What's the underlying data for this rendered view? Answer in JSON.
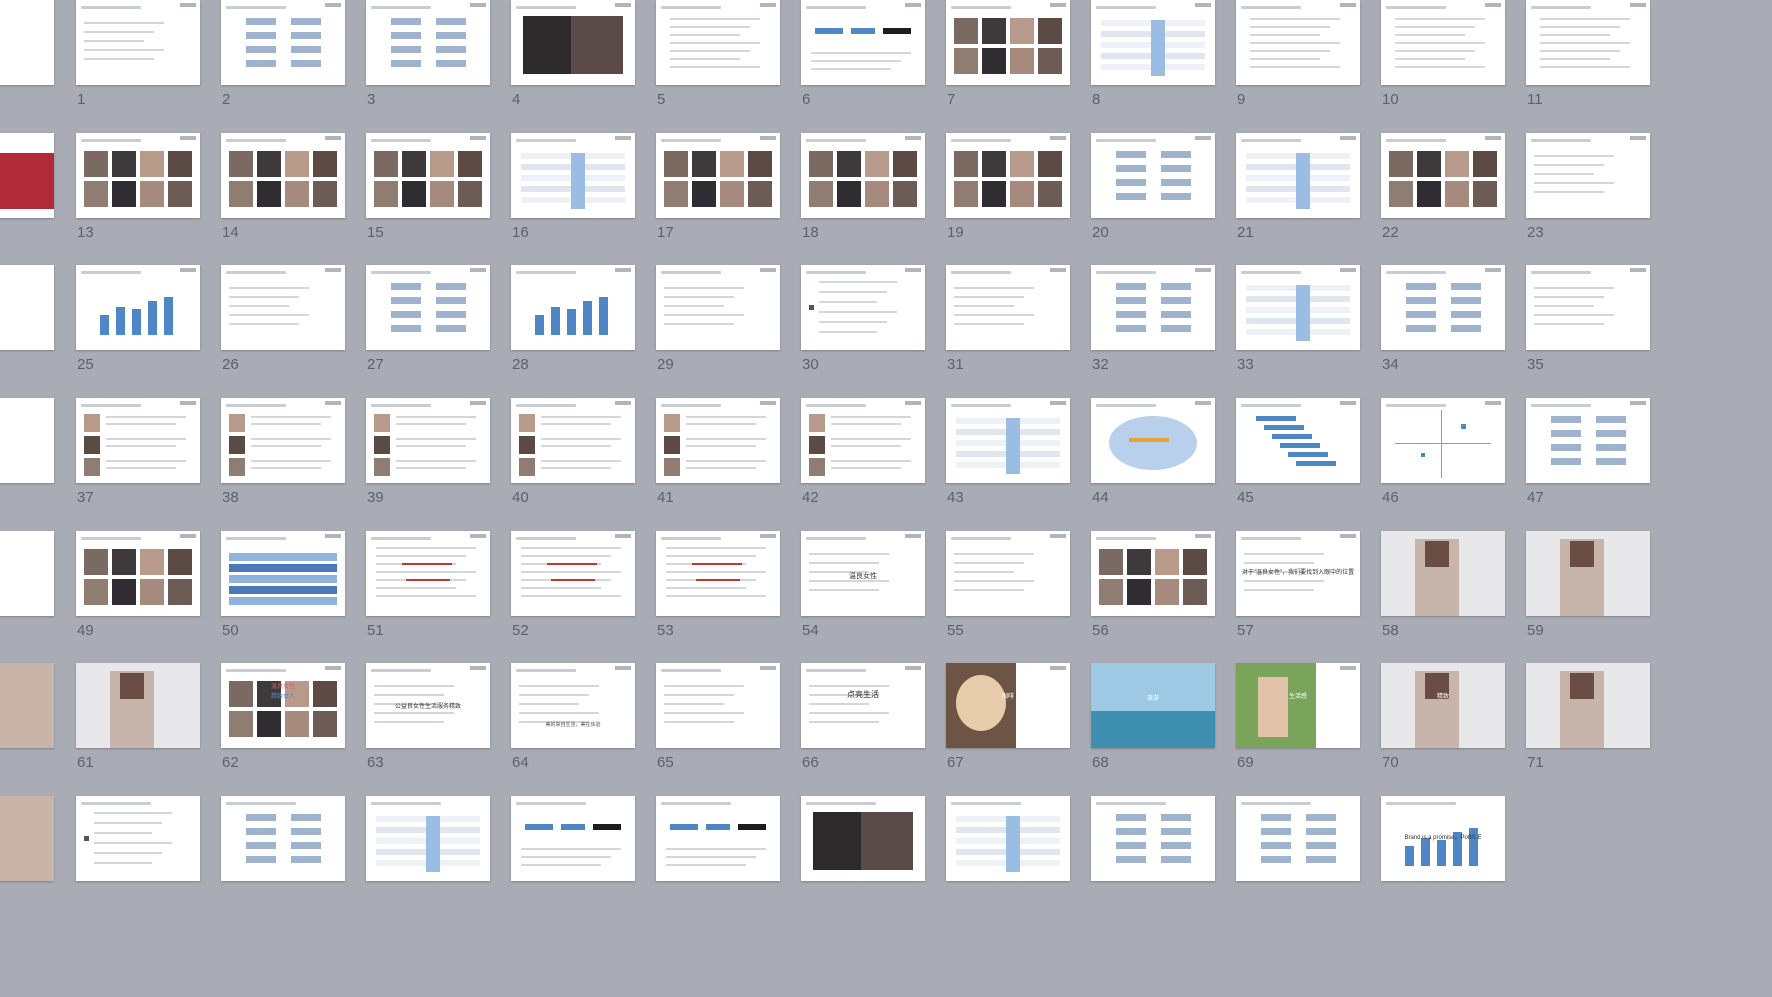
{
  "slide_numbers": [
    "1",
    "2",
    "3",
    "4",
    "5",
    "6",
    "7",
    "8",
    "9",
    "10",
    "11",
    "13",
    "14",
    "15",
    "16",
    "17",
    "18",
    "19",
    "20",
    "21",
    "22",
    "23",
    "25",
    "26",
    "27",
    "28",
    "29",
    "30",
    "31",
    "32",
    "33",
    "34",
    "35",
    "37",
    "38",
    "39",
    "40",
    "41",
    "42",
    "43",
    "44",
    "45",
    "46",
    "47",
    "49",
    "50",
    "51",
    "52",
    "53",
    "54",
    "55",
    "56",
    "57",
    "58",
    "59",
    "61",
    "62",
    "63",
    "64",
    "65",
    "66",
    "67",
    "68",
    "69",
    "70",
    "71"
  ],
  "slide_texts": {
    "54": "温良女性",
    "57": "对于\"温良女性\"，我们要找到入眼中的位置",
    "62a": "温良女性",
    "62b": "精致女人",
    "63": "公益良女性生活服务精致",
    "64": "美的来自生活，美在体验",
    "66": "点亮生活",
    "67": "咖啡",
    "68": "旅游",
    "69": "生活感",
    "70": "精致",
    "79": "Brand is a promise，PoBS E"
  },
  "colors": {
    "background": "#a9acb5",
    "slide": "#ffffff",
    "number_text": "#5c6069",
    "accent_blue": "#4f86c6",
    "accent_red": "#c0392b",
    "accent_orange": "#e8a13a"
  }
}
